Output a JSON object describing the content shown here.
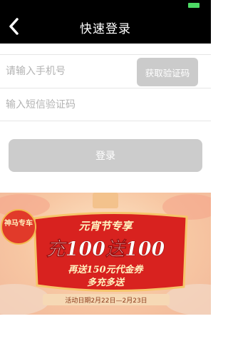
{
  "header": {
    "title": "快速登录"
  },
  "form": {
    "phone_placeholder": "请输入手机号",
    "code_placeholder": "输入短信验证码",
    "get_code_label": "获取验证码",
    "login_label": "登录"
  },
  "banner": {
    "badge": "神马专车",
    "subtitle": "元宵节专享",
    "main": "充100送100",
    "line2": "再送150元代金券",
    "line3": "多充多送",
    "date": "活动日期2月22日—2月23日"
  },
  "colors": {
    "nav_bg": "#000000",
    "banner_red": "#d8221f",
    "button_disabled": "#cccccc"
  }
}
